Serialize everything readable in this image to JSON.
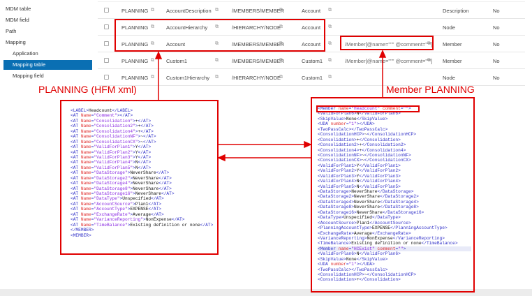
{
  "sidebar": {
    "items": [
      {
        "label": "MDM table"
      },
      {
        "label": "MDM field"
      },
      {
        "label": "Path"
      },
      {
        "label": "Mapping"
      },
      {
        "label": "Application"
      },
      {
        "label": "Mapping table",
        "active": true
      },
      {
        "label": "Mapping field"
      }
    ]
  },
  "table": {
    "rows": [
      {
        "app": "PLANNING",
        "name": "AccountDescription",
        "path": "/MEMBERS/MEMBER",
        "dim": "Account",
        "xpath": "",
        "type": "Description",
        "flag": "No"
      },
      {
        "app": "PLANNING",
        "name": "AccountHierarchy",
        "path": "/HIERARCHY/NODE",
        "dim": "Account",
        "xpath": "",
        "type": "Node",
        "flag": "No"
      },
      {
        "app": "PLANNING",
        "name": "Account",
        "path": "/MEMBERS/MEMBER",
        "dim": "Account",
        "xpath": "/Member[@name=\"\"\" @comment=\"\"\"]",
        "type": "Member",
        "flag": "No"
      },
      {
        "app": "PLANNING",
        "name": "Custom1",
        "path": "/MEMBERS/MEMBER",
        "dim": "Custom1",
        "xpath": "/Member[@name=\"\"\" @comment=\"\"\"]",
        "type": "Member",
        "flag": "No"
      },
      {
        "app": "PLANNING",
        "name": "Custom1Hierarchy",
        "path": "/HIERARCHY/NODE",
        "dim": "Custom1",
        "xpath": "",
        "type": "Node",
        "flag": "No"
      }
    ]
  },
  "annotations": {
    "left_title": "PLANNING  (HFM xml)",
    "right_title": "Member PLANNING",
    "color": "#e00000"
  },
  "left_xml": [
    "<LABEL>Headcount</LABEL>",
    "<AT Name=\"Comment\"></AT>",
    "<AT Name=\"Consolidation\">+</AT>",
    "<AT Name=\"Consolidation2\">+</AT>",
    "<AT Name=\"Consolidation4\">+</AT>",
    "<AT Name=\"ConsolidationNF\">~</AT>",
    "<AT Name=\"ConsolidationCX\">~</AT>",
    "<AT Name=\"ValidForPlan1\">Y</AT>",
    "<AT Name=\"ValidForPlan2\">Y</AT>",
    "<AT Name=\"ValidForPlan3\">Y</AT>",
    "<AT Name=\"ValidForPlan4\">N</AT>",
    "<AT Name=\"ValidForPlan5\">N</AT>",
    "<AT Name=\"DataStorage\">NeverShare</AT>",
    "<AT Name=\"DataStorage2\">NeverShare</AT>",
    "<AT Name=\"DataStorage4\">NeverShare</AT>",
    "<AT Name=\"DataStorage8\">NeverShare</AT>",
    "<AT Name=\"DataStorage16\">NeverShare</AT>",
    "<AT Name=\"DataType\">Unspecified</AT>",
    "<AT Name=\"AccountSource\">Plan1</AT>",
    "<AT Name=\"AccountType\">EXPENSE</AT>",
    "<AT Name=\"ExchangeRate\">Average</AT>",
    "<AT Name=\"VarianceReporting\">NonExpense</AT>",
    "<AT Name=\"TimeBalance\">Existing definition or none</AT>",
    "</MEMBER>",
    "<MEMBER>"
  ],
  "right_xml": [
    "<Member name=\"Headcount\" comment=\"\">",
    "<ValidForPlan6>N</ValidForPlan6>",
    "<SkipValue>None</SkipValue>",
    "<UDA number=\"1\"></UDA>",
    "<TwoPassCalc></TwoPassCalc>",
    "<ConsolidationHCP>~</ConsolidationHCP>",
    "<Consolidation>+</Consolidation>",
    "<Consolidation2>+</Consolidation2>",
    "<Consolidation4>+</Consolidation4>",
    "<ConsolidationNF>~</ConsolidationNF>",
    "<ConsolidationCX>~</ConsolidationCX>",
    "<ValidForPlan1>Y</ValidForPlan1>",
    "<ValidForPlan2>Y</ValidForPlan2>",
    "<ValidForPlan3>Y</ValidForPlan3>",
    "<ValidForPlan4>N</ValidForPlan4>",
    "<ValidForPlan5>N</ValidForPlan5>",
    "<DataStorage>NeverShare</DataStorage>",
    "<DataStorage2>NeverShare</DataStorage2>",
    "<DataStorage4>NeverShare</DataStorage4>",
    "<DataStorage8>NeverShare</DataStorage8>",
    "<DataStorage16>NeverShare</DataStorage16>",
    "<DataType>Unspecified</DataType>",
    "<AccountSource>Plan1</AccountSource>",
    "<PlanningAccountType>EXPENSE</PlanningAccountType>",
    "<ExchangeRate>Average</ExchangeRate>",
    "<VarianceReporting>NonExpense</VarianceReporting>",
    "<TimeBalance>Existing definition or none</TimeBalance>",
    "<Member name=\"HCExist\" comment=\"\">",
    "<ValidForPlan6>N</ValidForPlan6>",
    "<SkipValue>None</SkipValue>",
    "<UDA number=\"1\"></UDA>",
    "<TwoPassCalc></TwoPassCalc>",
    "<ConsolidationHCP>~</ConsolidationHCP>",
    "<Consolidation>+</Consolidation>"
  ]
}
